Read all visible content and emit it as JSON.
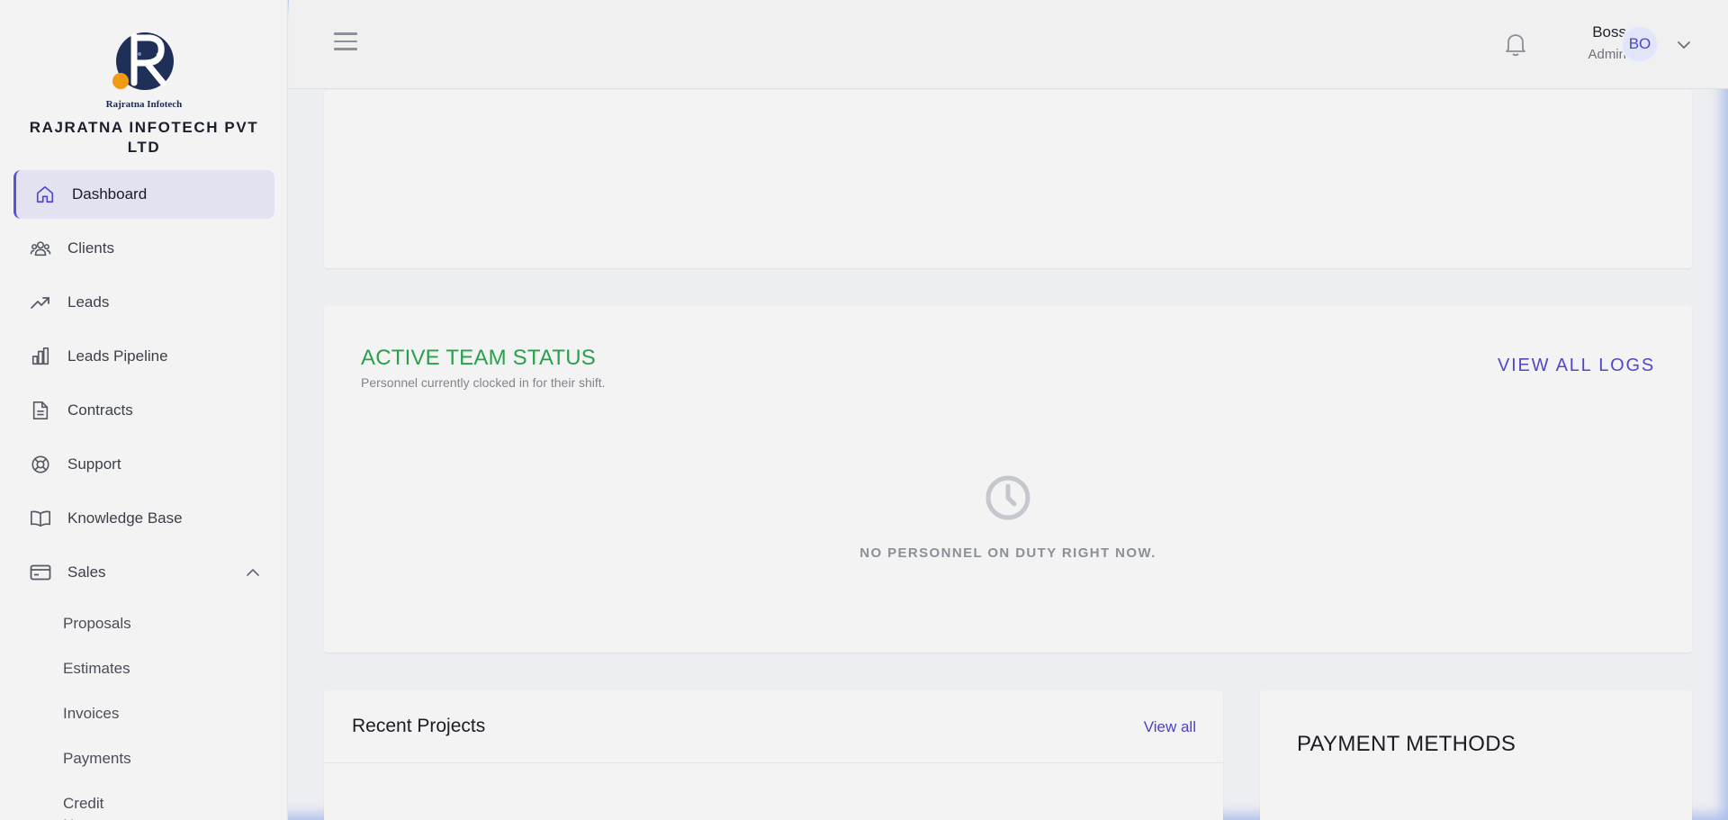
{
  "brand": {
    "logo_caption": "Rajratna Infotech",
    "company_name": "RAJRATNA INFOTECH PVT LTD"
  },
  "sidebar": {
    "items": [
      {
        "label": "Dashboard",
        "icon": "home-icon",
        "active": true
      },
      {
        "label": "Clients",
        "icon": "users-icon"
      },
      {
        "label": "Leads",
        "icon": "trending-up-icon"
      },
      {
        "label": "Leads Pipeline",
        "icon": "bar-chart-icon"
      },
      {
        "label": "Contracts",
        "icon": "document-icon"
      },
      {
        "label": "Support",
        "icon": "lifebuoy-icon"
      },
      {
        "label": "Knowledge Base",
        "icon": "book-icon"
      },
      {
        "label": "Sales",
        "icon": "credit-card-icon",
        "expanded": true
      }
    ],
    "sales_subitems": [
      "Proposals",
      "Estimates",
      "Invoices",
      "Payments",
      "Credit Notes"
    ]
  },
  "header": {
    "user_name": "Boss",
    "user_role": "Admin",
    "avatar_initials": "BO"
  },
  "team_status": {
    "title": "ACTIVE TEAM STATUS",
    "subtitle": "Personnel currently clocked in for their shift.",
    "view_logs_label": "VIEW ALL LOGS",
    "empty_message": "NO PERSONNEL ON DUTY RIGHT NOW."
  },
  "recent_projects": {
    "title": "Recent Projects",
    "view_all_label": "View all"
  },
  "payment_methods": {
    "title": "PAYMENT METHODS"
  },
  "colors": {
    "accent": "#5148c9",
    "success": "#27a24a",
    "active_bg": "#e3e2f1"
  }
}
